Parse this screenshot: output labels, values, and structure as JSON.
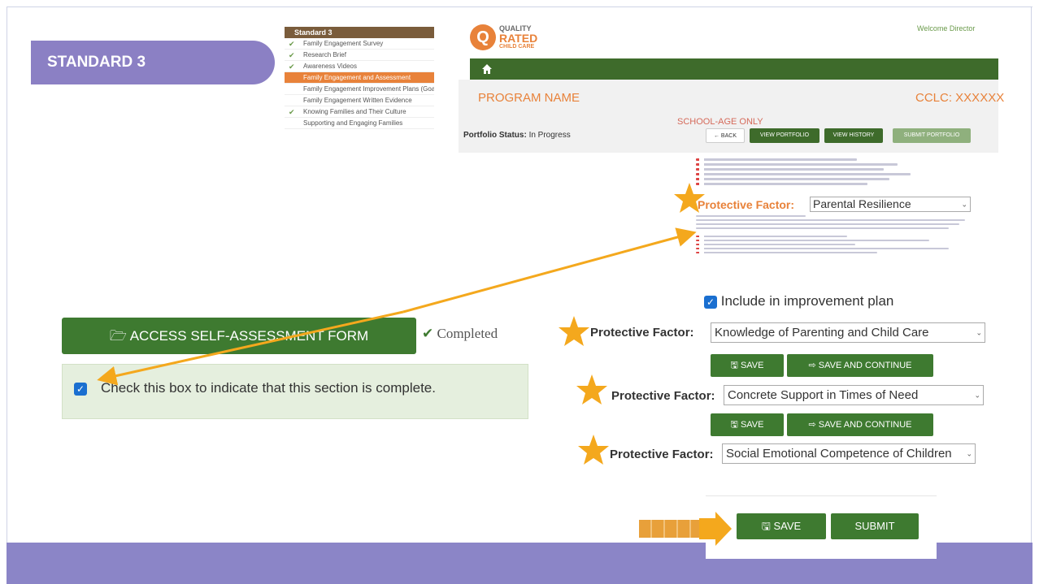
{
  "slide": {
    "banner_title": "STANDARD 3",
    "colors": {
      "banner": "#8b80c4",
      "footer": "#8b85c7",
      "accent_orange": "#e8823a",
      "brand_green": "#3e7a30",
      "star": "#f4a81d"
    }
  },
  "sidebar": {
    "header": "Standard 3",
    "items": [
      {
        "label": "Family Engagement Survey",
        "checked": true
      },
      {
        "label": "Research Brief",
        "checked": true
      },
      {
        "label": "Awareness Videos",
        "checked": true
      },
      {
        "label": "Family Engagement and Assessment",
        "checked": false,
        "active": true
      },
      {
        "label": "Family Engagement Improvement Plans (Goals)",
        "checked": false
      },
      {
        "label": "Family Engagement Written Evidence",
        "checked": false
      },
      {
        "label": "Knowing Families and Their Culture",
        "checked": true
      },
      {
        "label": "Supporting and Engaging Families",
        "checked": false
      }
    ]
  },
  "portal": {
    "logo_line1": "QUALITY",
    "logo_line2": "RATED",
    "logo_line3": "CHILD CARE",
    "logo_letter": "Q",
    "welcome": "Welcome Director",
    "program_name": "PROGRAM NAME",
    "cclc": "CCLC: XXXXXX",
    "school_age": "SCHOOL-AGE ONLY",
    "portfolio_status_label": "Portfolio Status:",
    "portfolio_status_value": "In Progress",
    "buttons": {
      "back": "← BACK",
      "view_portfolio": "VIEW PORTFOLIO",
      "view_history": "VIEW HISTORY",
      "submit_portfolio": "SUBMIT PORTFOLIO"
    }
  },
  "form": {
    "pf1_label": "Protective Factor:",
    "pf1_value": "Parental Resilience",
    "include_label": "Include in improvement plan",
    "pf2_label": "Protective Factor:",
    "pf2_value": "Knowledge of Parenting and Child Care",
    "pf3_label": "Protective Factor:",
    "pf3_value": "Concrete Support in Times of Need",
    "pf4_label": "Protective Factor:",
    "pf4_value": "Social Emotional Competence of Children",
    "save": "SAVE",
    "save_continue": "SAVE AND CONTINUE",
    "bottom_save": "SAVE",
    "submit": "SUBMIT"
  },
  "self_assessment": {
    "access_button": "ACCESS SELF-ASSESSMENT FORM",
    "completed": "Completed",
    "confirm_text": "Check this box to indicate that this section is complete."
  }
}
